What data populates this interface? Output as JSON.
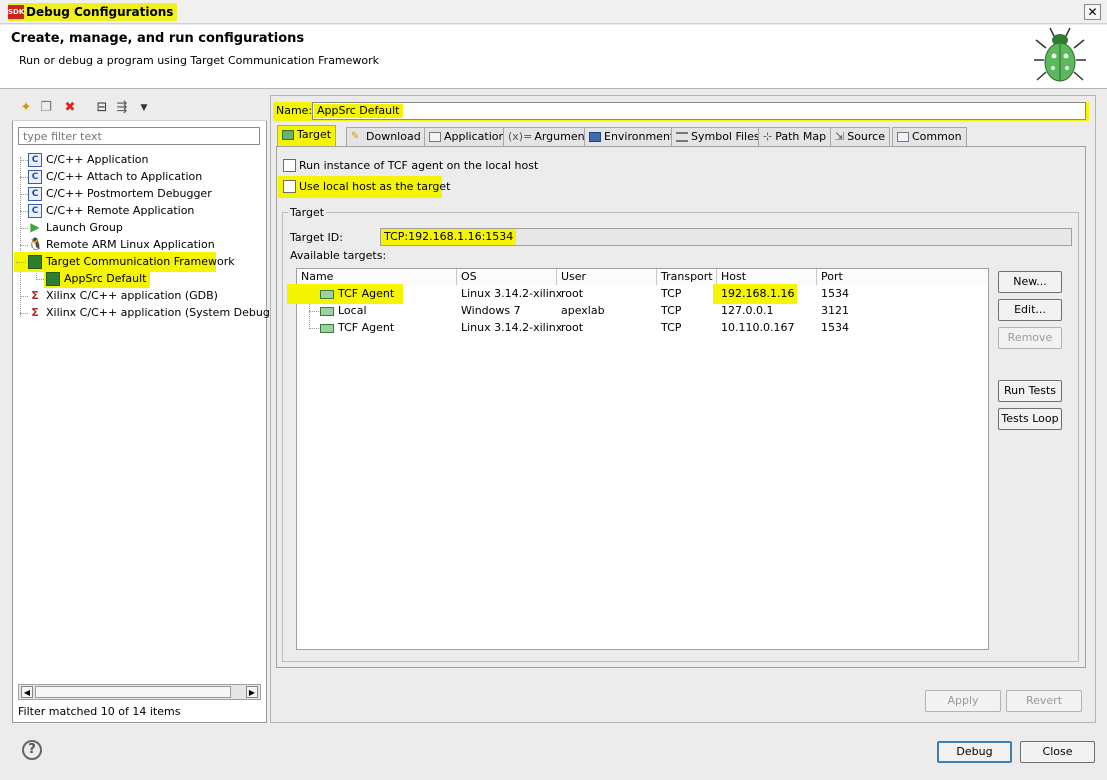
{
  "window": {
    "title": "Debug Configurations",
    "app_badge": "SDK",
    "close_glyph": "✕"
  },
  "banner": {
    "title": "Create, manage, and run configurations",
    "subtitle": "Run or debug a program using Target Communication Framework"
  },
  "left": {
    "filter_placeholder": "type filter text",
    "tree": [
      {
        "label": "C/C++ Application",
        "icon": "c-icon"
      },
      {
        "label": "C/C++ Attach to Application",
        "icon": "c-icon"
      },
      {
        "label": "C/C++ Postmortem Debugger",
        "icon": "c-icon"
      },
      {
        "label": "C/C++ Remote Application",
        "icon": "c-icon"
      },
      {
        "label": "Launch Group",
        "icon": "launch-icon"
      },
      {
        "label": "Remote ARM Linux Application",
        "icon": "linux-icon"
      },
      {
        "label": "Target Communication Framework",
        "icon": "tcf-icon"
      },
      {
        "label": "AppSrc Default",
        "icon": "tcf-icon"
      },
      {
        "label": "Xilinx C/C++ application (GDB)",
        "icon": "gdb-icon"
      },
      {
        "label": "Xilinx C/C++ application (System Debugger)",
        "icon": "tcf-small-icon"
      }
    ],
    "filter_status": "Filter matched 10 of 14 items"
  },
  "right": {
    "name_label": "Name:",
    "name_value": "AppSrc Default",
    "tabs": [
      {
        "label": "Target"
      },
      {
        "label": "Download"
      },
      {
        "label": "Application"
      },
      {
        "label": "Arguments"
      },
      {
        "label": "Environment"
      },
      {
        "label": "Symbol Files"
      },
      {
        "label": "Path Map"
      },
      {
        "label": "Source"
      },
      {
        "label": "Common"
      }
    ],
    "check_run_local": "Run instance of TCF agent on the local host",
    "check_use_local": "Use local host as the target",
    "group_label": "Target",
    "target_id_label": "Target ID:",
    "target_id_value": "TCP:192.168.1.16:1534",
    "available_label": "Available targets:",
    "columns": [
      "Name",
      "OS",
      "User",
      "Transport",
      "Host",
      "Port"
    ],
    "rows": [
      {
        "name": "TCF Agent",
        "os": "Linux 3.14.2-xilinx",
        "user": "root",
        "transport": "TCP",
        "host": "192.168.1.16",
        "port": "1534"
      },
      {
        "name": "Local",
        "os": "Windows 7",
        "user": "apexlab",
        "transport": "TCP",
        "host": "127.0.0.1",
        "port": "3121"
      },
      {
        "name": "TCF Agent",
        "os": "Linux 3.14.2-xilinx",
        "user": "root",
        "transport": "TCP",
        "host": "10.110.0.167",
        "port": "1534"
      }
    ],
    "side_buttons": {
      "new": "New...",
      "edit": "Edit...",
      "remove": "Remove",
      "run_tests": "Run Tests",
      "tests_loop": "Tests Loop"
    },
    "apply": "Apply",
    "revert": "Revert"
  },
  "footer": {
    "help": "?",
    "debug": "Debug",
    "close": "Close"
  },
  "colors": {
    "highlight": "#f5f500"
  }
}
